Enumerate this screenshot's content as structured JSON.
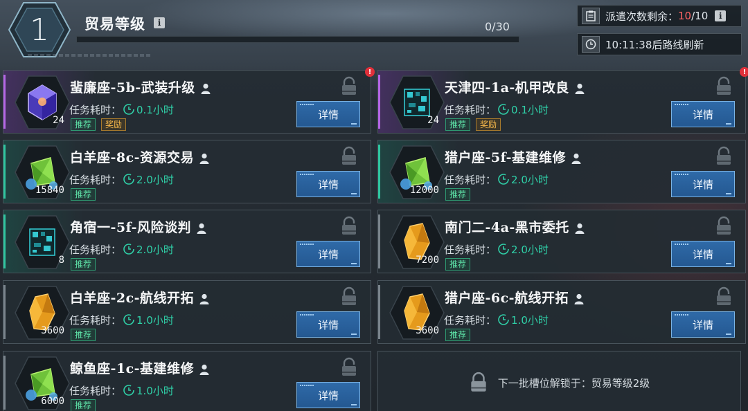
{
  "header": {
    "level": "1",
    "title": "贸易等级",
    "info_badge": "i",
    "progress_text": "0/30",
    "progress_fraction": 0,
    "dispatch": {
      "label": "派遣次数剩余：",
      "remaining": "10",
      "total": "/10",
      "info_badge": "i"
    },
    "refresh": {
      "text": "10:11:38后路线刷新"
    }
  },
  "colors": {
    "accent_teal": "#2fd0a8",
    "button_blue": "#2a62a0",
    "alert_red": "#e0303a",
    "remaining_red": "#ff6464"
  },
  "duration_label": "任务耗时：",
  "detail_label": "详情",
  "tags": {
    "recommend": "推荐",
    "reward": "奖励"
  },
  "cards": [
    {
      "title": "蜚廉座-5b-武装升级",
      "duration": "0.1小时",
      "count": "24",
      "icon": "purple-crystal-cube-icon",
      "rarity": "purple",
      "tags": [
        "recommend",
        "reward"
      ],
      "alert": true
    },
    {
      "title": "天津四-1a-机甲改良",
      "duration": "0.1小时",
      "count": "24",
      "icon": "tech-block-icon",
      "rarity": "purple",
      "tags": [
        "recommend",
        "reward"
      ],
      "alert": true
    },
    {
      "title": "白羊座-8c-资源交易",
      "duration": "2.0小时",
      "count": "15840",
      "icon": "green-crystal-icon",
      "rarity": "teal",
      "tags": [
        "recommend"
      ],
      "alert": false
    },
    {
      "title": "猎户座-5f-基建维修",
      "duration": "2.0小时",
      "count": "12000",
      "icon": "green-crystal-icon",
      "rarity": "teal",
      "tags": [
        "recommend"
      ],
      "alert": false
    },
    {
      "title": "角宿一-5f-风险谈判",
      "duration": "2.0小时",
      "count": "8",
      "icon": "tech-block-icon",
      "rarity": "teal",
      "tags": [
        "recommend"
      ],
      "alert": false
    },
    {
      "title": "南门二-4a-黑市委托",
      "duration": "2.0小时",
      "count": "7200",
      "icon": "amber-crystal-icon",
      "rarity": "grey",
      "tags": [
        "recommend"
      ],
      "alert": false
    },
    {
      "title": "白羊座-2c-航线开拓",
      "duration": "1.0小时",
      "count": "3600",
      "icon": "amber-crystal-icon",
      "rarity": "grey",
      "tags": [
        "recommend"
      ],
      "alert": false
    },
    {
      "title": "猎户座-6c-航线开拓",
      "duration": "1.0小时",
      "count": "3600",
      "icon": "amber-crystal-icon",
      "rarity": "grey",
      "tags": [
        "recommend"
      ],
      "alert": false
    },
    {
      "title": "鲸鱼座-1c-基建维修",
      "duration": "1.0小时",
      "count": "6000",
      "icon": "green-crystal-icon",
      "rarity": "grey",
      "tags": [
        "recommend"
      ],
      "alert": false
    }
  ],
  "locked_slot": {
    "text": "下一批槽位解锁于：贸易等级2级"
  }
}
